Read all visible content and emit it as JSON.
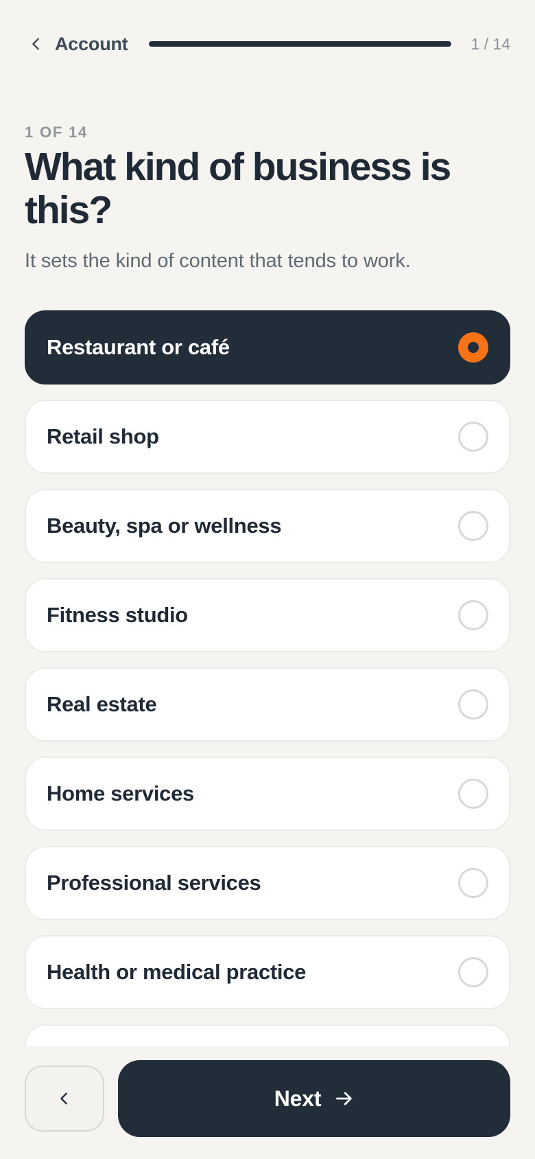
{
  "header": {
    "back_label": "Account",
    "step_count": "1 / 14",
    "progress_fraction": 1
  },
  "question": {
    "eyebrow": "1 OF 14",
    "title": "What kind of business is this?",
    "subtitle": "It sets the kind of content that tends to work."
  },
  "options": [
    {
      "label": "Restaurant or café",
      "selected": true
    },
    {
      "label": "Retail shop",
      "selected": false
    },
    {
      "label": "Beauty, spa or wellness",
      "selected": false
    },
    {
      "label": "Fitness studio",
      "selected": false
    },
    {
      "label": "Real estate",
      "selected": false
    },
    {
      "label": "Home services",
      "selected": false
    },
    {
      "label": "Professional services",
      "selected": false
    },
    {
      "label": "Health or medical practice",
      "selected": false
    },
    {
      "label": "",
      "selected": false
    }
  ],
  "footer": {
    "next_label": "Next"
  },
  "colors": {
    "background": "#f5f4f1",
    "primary_dark": "#222d3a",
    "accent": "#f97316",
    "card": "#ffffff"
  },
  "icons": {
    "back": "chevron-left-icon",
    "prev": "chevron-left-icon",
    "next": "arrow-right-icon",
    "radio": "radio-icon"
  }
}
